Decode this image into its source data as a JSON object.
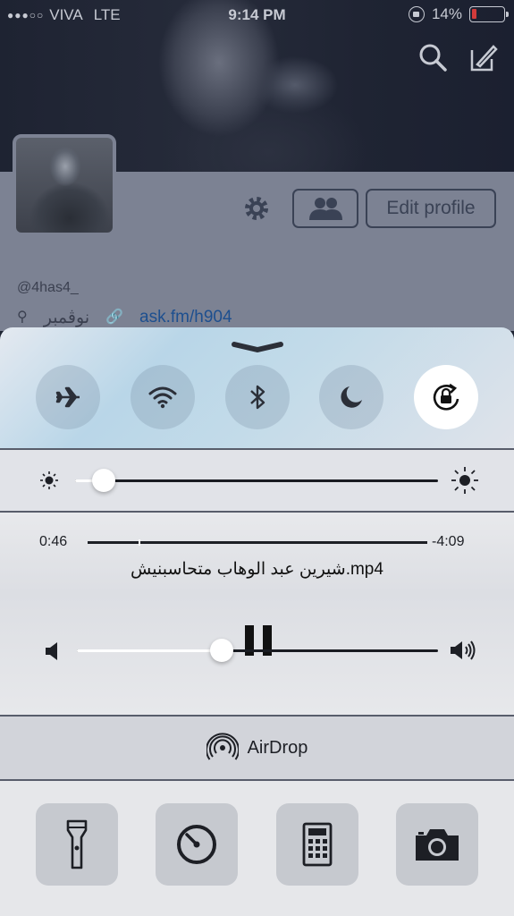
{
  "status_bar": {
    "signal": "●●●○○",
    "carrier": "VIVA",
    "network": "LTE",
    "time": "9:14 PM",
    "battery_percent": "14%",
    "battery_level": 0.14,
    "battery_color": "#d13b3b"
  },
  "profile": {
    "edit_label": "Edit profile",
    "handle": "@4has4_",
    "location": "نوڤمبر",
    "link": "ask.fm/h904"
  },
  "control_center": {
    "toggles": [
      {
        "name": "airplane-mode",
        "on": false
      },
      {
        "name": "wifi",
        "on": false
      },
      {
        "name": "bluetooth",
        "on": false
      },
      {
        "name": "do-not-disturb",
        "on": false
      },
      {
        "name": "rotation-lock",
        "on": true
      }
    ],
    "brightness_level": 0.08,
    "media": {
      "elapsed": "0:46",
      "remaining": "-4:09",
      "progress": 0.15,
      "title": "شيرين عبد الوهاب متحاسبنيش.mp4",
      "volume_level": 0.4
    },
    "airdrop_label": "AirDrop",
    "tools": [
      "flashlight-icon",
      "timer-icon",
      "calculator-icon",
      "camera-icon"
    ]
  }
}
